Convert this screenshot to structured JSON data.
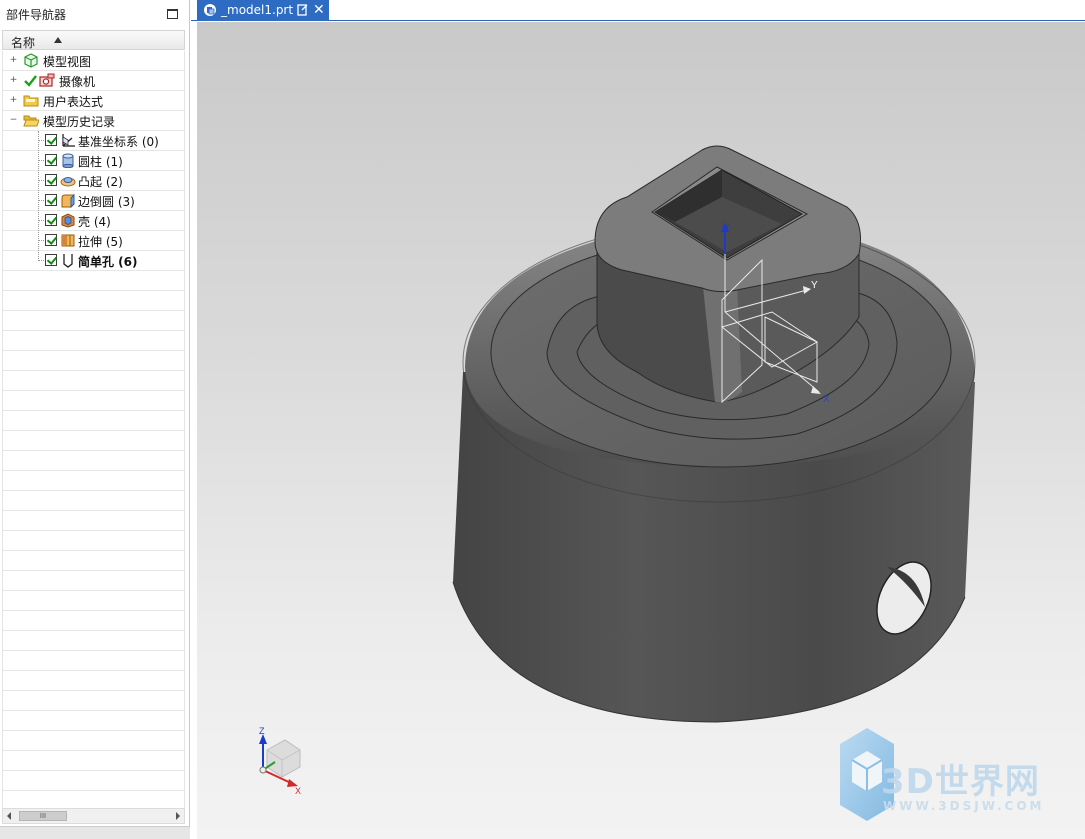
{
  "navigator": {
    "title": "部件导航器",
    "column_header": "名称",
    "items": [
      {
        "label": "模型视图",
        "expander": "+",
        "icon": "model-views-icon"
      },
      {
        "label": "摄像机",
        "expander": "+",
        "icon": "camera-icon"
      },
      {
        "label": "用户表达式",
        "expander": "+",
        "icon": "folder-icon"
      },
      {
        "label": "模型历史记录",
        "expander": "−",
        "icon": "folder-open-icon"
      }
    ],
    "features": [
      {
        "label": "基准坐标系 (0)",
        "icon": "datum-csys-icon",
        "bold": false
      },
      {
        "label": "圆柱 (1)",
        "icon": "cylinder-icon",
        "bold": false
      },
      {
        "label": "凸起 (2)",
        "icon": "emboss-icon",
        "bold": false
      },
      {
        "label": "边倒圆 (3)",
        "icon": "edge-blend-icon",
        "bold": false
      },
      {
        "label": "壳 (4)",
        "icon": "shell-icon",
        "bold": false
      },
      {
        "label": "拉伸 (5)",
        "icon": "extrude-icon",
        "bold": false
      },
      {
        "label": "简单孔 (6)",
        "icon": "hole-icon",
        "bold": true
      }
    ],
    "scroll_thumb": "III"
  },
  "tab": {
    "name": "_model1.prt",
    "close_glyph": "✕"
  },
  "viewport": {
    "axis_labels": {
      "z": "Z",
      "y": "Y",
      "x": "X"
    },
    "triad_labels": {
      "z": "Z",
      "x": "X"
    },
    "watermark_text": "3D世界网",
    "watermark_url": "WWW.3DSJW.COM"
  },
  "colors": {
    "tab_active": "#2e6cc4",
    "check_green": "#118a11",
    "model_gray": "#5a5a5a",
    "watermark": "#bed7eb"
  }
}
